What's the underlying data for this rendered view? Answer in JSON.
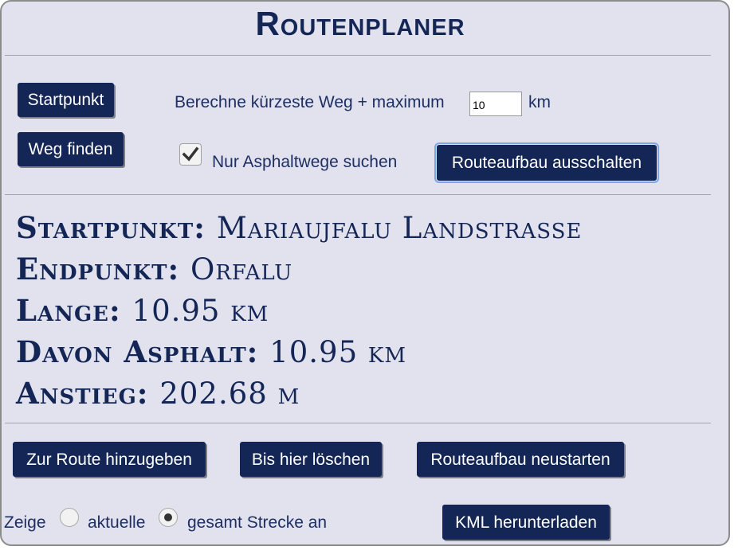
{
  "title": "Routenplaner",
  "controls": {
    "start_button": "Startpunkt",
    "find_button": "Weg finden",
    "calc_label": "Berechne kürzeste Weg + maximum",
    "max_value": "10",
    "unit_km": "km",
    "asphalt_checked": true,
    "asphalt_label": "Nur Asphaltwege suchen",
    "toggle_route_button": "Routeaufbau ausschalten"
  },
  "info": {
    "start_label": "Startpunkt:",
    "start_value": "Mariaujfalu Landstrasse",
    "end_label": "Endpunkt:",
    "end_value": "Orfalu",
    "length_label": "Lange:",
    "length_value": "10.95 km",
    "asphalt_label": "Davon Asphalt:",
    "asphalt_value": "10.95 km",
    "ascent_label": "Anstieg:",
    "ascent_value": "202.68 m"
  },
  "actions": {
    "add_button": "Zur Route hinzugeben",
    "delete_button": "Bis hier löschen",
    "restart_button": "Routeaufbau neustarten"
  },
  "display": {
    "show_label": "Zeige",
    "current_label": "aktuelle",
    "total_label": "gesamt Strecke an",
    "selected": "total",
    "kml_button": "KML herunterladen"
  }
}
